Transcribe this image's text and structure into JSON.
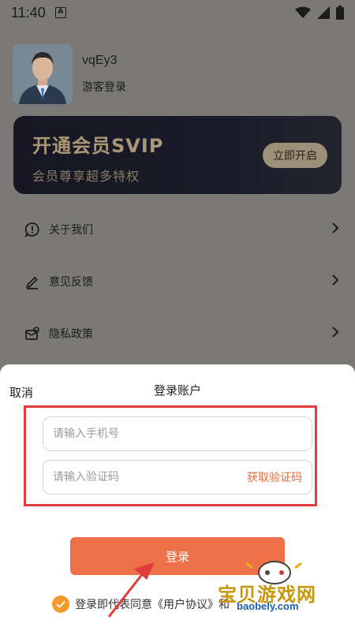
{
  "status_bar": {
    "time": "11:40",
    "notification_icon": "a-icon",
    "wifi_icon": "wifi-icon",
    "signal_icon": "signal-icon",
    "battery_icon": "battery-icon"
  },
  "profile": {
    "username": "vqEy3",
    "login_type": "游客登录",
    "avatar_icon": "avatar"
  },
  "vip": {
    "title": "开通会员SVIP",
    "subtitle": "会员尊享超多特权",
    "button": "立即开启"
  },
  "menu": [
    {
      "label": "关于我们",
      "icon": "info-icon"
    },
    {
      "label": "意见反馈",
      "icon": "pencil-icon"
    },
    {
      "label": "隐私政策",
      "icon": "privacy-icon"
    }
  ],
  "login_sheet": {
    "cancel": "取消",
    "title": "登录账户",
    "phone_placeholder": "请输入手机号",
    "code_placeholder": "请输入验证码",
    "get_code": "获取验证码",
    "login_button": "登录",
    "agreement_prefix": "登录即代表同意",
    "agreement_user": "《用户协议》",
    "agreement_and": "和"
  },
  "colors": {
    "accent": "#ee7049",
    "highlight": "#e23b3b",
    "vip_gold": "#a99777"
  },
  "watermark": {
    "text": "宝贝游戏网",
    "url": "baobely.com"
  }
}
